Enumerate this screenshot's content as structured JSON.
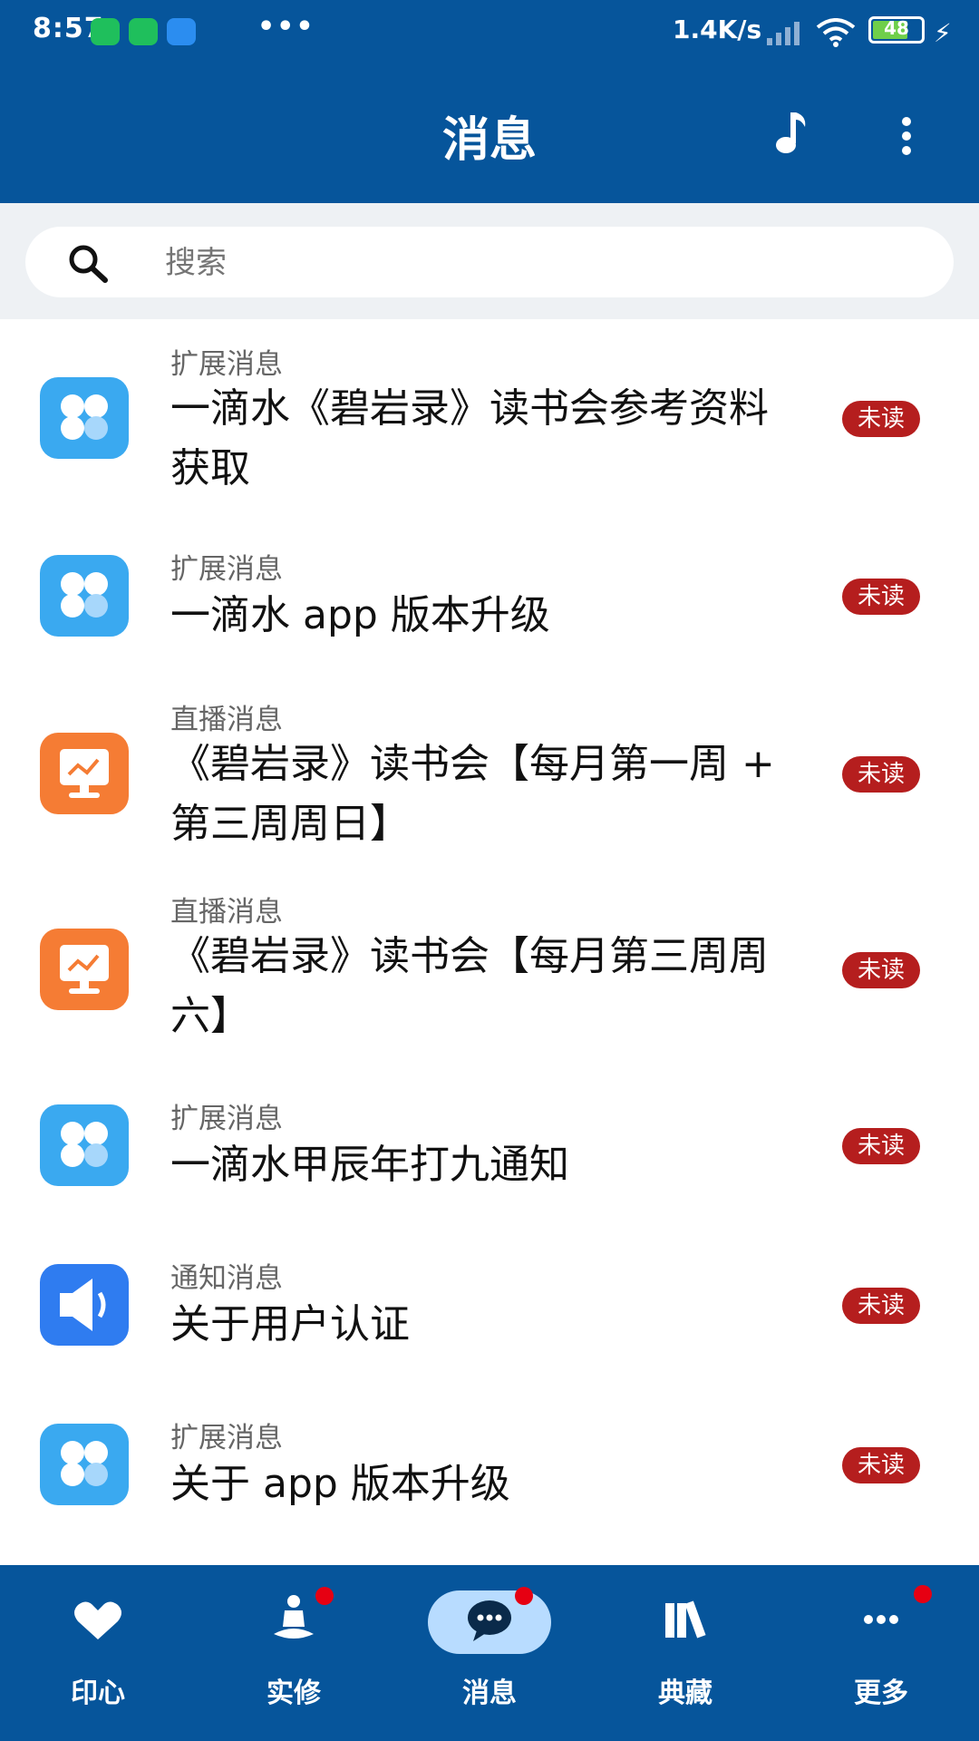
{
  "status_bar": {
    "time": "8:57",
    "net_speed": "1.4K/s",
    "battery": "48"
  },
  "header": {
    "title": "消息",
    "music_icon": "music-note-icon",
    "more_icon": "more-vertical-icon"
  },
  "search": {
    "placeholder": "搜索"
  },
  "messages": [
    {
      "category": "扩展消息",
      "title": "一滴水《碧岩录》读书会参考资料获取",
      "badge": "未读",
      "icon": "clover-icon"
    },
    {
      "category": "扩展消息",
      "title": "一滴水 app 版本升级",
      "badge": "未读",
      "icon": "clover-icon"
    },
    {
      "category": "直播消息",
      "title": "《碧岩录》读书会【每月第一周 + 第三周周日】",
      "badge": "未读",
      "icon": "live-monitor-icon"
    },
    {
      "category": "直播消息",
      "title": "《碧岩录》读书会【每月第三周周六】",
      "badge": "未读",
      "icon": "live-monitor-icon"
    },
    {
      "category": "扩展消息",
      "title": "一滴水甲辰年打九通知",
      "badge": "未读",
      "icon": "clover-icon"
    },
    {
      "category": "通知消息",
      "title": "关于用户认证",
      "badge": "未读",
      "icon": "speaker-icon"
    },
    {
      "category": "扩展消息",
      "title": "关于 app 版本升级",
      "badge": "未读",
      "icon": "clover-icon"
    }
  ],
  "bottom_nav": [
    {
      "label": "印心",
      "icon": "heart-icon",
      "dot": false
    },
    {
      "label": "实修",
      "icon": "meditation-icon",
      "dot": true
    },
    {
      "label": "消息",
      "icon": "chat-bubble-icon",
      "dot": true,
      "active": true
    },
    {
      "label": "典藏",
      "icon": "books-icon",
      "dot": false
    },
    {
      "label": "更多",
      "icon": "more-horizontal-icon",
      "dot": true
    }
  ],
  "colors": {
    "brand": "#06559b",
    "badge": "#b51e1e",
    "active_pill": "#b8dcff",
    "dot": "#e60012"
  }
}
